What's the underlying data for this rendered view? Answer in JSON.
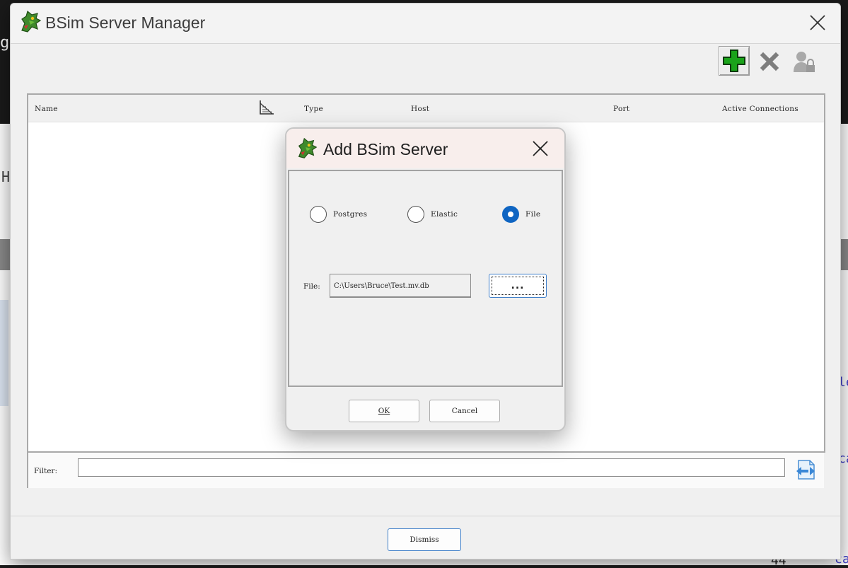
{
  "main_window": {
    "title": "BSim Server Manager",
    "table": {
      "columns": [
        "Name",
        "Type",
        "Host",
        "Port",
        "Active Connections"
      ]
    },
    "filter": {
      "label": "Filter:",
      "value": ""
    },
    "dismiss_label": "Dismiss",
    "toolbar": {
      "add_icon": "green-plus-icon",
      "remove_icon": "gray-x-icon",
      "user_icon": "user-lock-icon"
    }
  },
  "dialog": {
    "title": "Add BSim Server",
    "radios": [
      {
        "label": "Postgres",
        "checked": false
      },
      {
        "label": "Elastic",
        "checked": false
      },
      {
        "label": "File",
        "checked": true
      }
    ],
    "file_label": "File:",
    "file_value": "C:\\Users\\Bruce\\Test.mv.db",
    "browse_label": "...",
    "ok_label": "OK",
    "cancel_label": "Cancel"
  },
  "background": {
    "glyphs": [
      "g.",
      "H",
      "le",
      "ca",
      "ca",
      "44"
    ]
  },
  "colors": {
    "accent": "#0f65c2",
    "add_green": "#1aa31a"
  }
}
